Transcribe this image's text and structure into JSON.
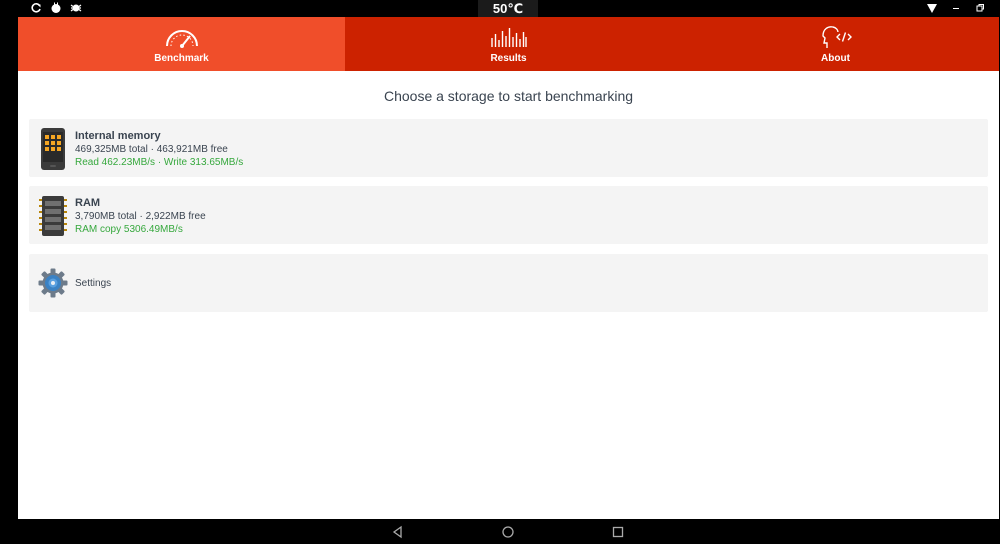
{
  "status_bar": {
    "temperature": "50℃",
    "icons": [
      "refresh-icon",
      "android-icon",
      "bug-icon",
      "wifi-icon",
      "minimize-icon",
      "restore-icon"
    ]
  },
  "tabs": [
    {
      "label": "Benchmark",
      "icon": "speedometer-icon",
      "active": true
    },
    {
      "label": "Results",
      "icon": "bar-chart-icon",
      "active": false
    },
    {
      "label": "About",
      "icon": "head-code-icon",
      "active": false
    }
  ],
  "main": {
    "heading": "Choose a storage to start benchmarking",
    "items": [
      {
        "title": "Internal memory",
        "subtitle": "469,325MB total · 463,921MB free",
        "speed": "Read 462.23MB/s · Write 313.65MB/s",
        "icon": "phone-icon"
      },
      {
        "title": "RAM",
        "subtitle": "3,790MB total · 2,922MB free",
        "speed": "RAM copy 5306.49MB/s",
        "icon": "memory-chip-icon"
      }
    ],
    "settings": {
      "label": "Settings",
      "icon": "gear-icon"
    }
  },
  "colors": {
    "tab_bar": "#cc2200",
    "tab_active": "#f04e2a",
    "speed_text": "#36a83d",
    "card_bg": "#f4f4f4"
  },
  "nav_bar": {
    "buttons": [
      "back-icon",
      "home-icon",
      "recents-icon"
    ]
  }
}
